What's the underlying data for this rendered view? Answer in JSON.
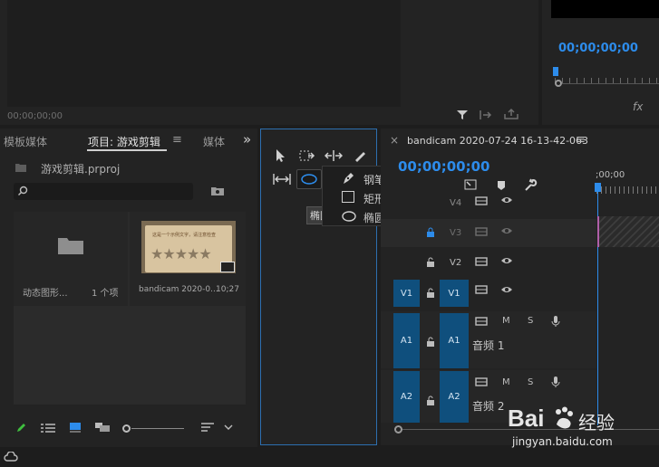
{
  "source_monitor": {
    "timecode": "00;00;00;00"
  },
  "program_monitor": {
    "timecode": "00;00;00;00",
    "fx_label": "fx"
  },
  "project_panel": {
    "tabs": [
      {
        "label": "模板媒体",
        "active": false
      },
      {
        "label": "项目: 游戏剪辑",
        "active": true
      },
      {
        "label": "媒体",
        "active": false
      }
    ],
    "menu_glyph": "≡",
    "overflow_glyph": "»",
    "project_file": "游戏剪辑.prproj",
    "search_placeholder": "",
    "items": [
      {
        "name": "动态图形...",
        "meta": "1 个项",
        "kind": "bin"
      },
      {
        "name": "bandicam 2020-0...",
        "meta": "10;27",
        "kind": "clip"
      }
    ],
    "thumb_text": "这是一个示例文字，请注意检查"
  },
  "tools_panel": {
    "tooltip": "椭圆工具",
    "flyout": [
      {
        "label": "钢笔工具 (P)",
        "icon": "pen-icon"
      },
      {
        "label": "矩形工具",
        "icon": "rectangle-icon"
      },
      {
        "label": "椭圆工具",
        "icon": "ellipse-icon"
      }
    ]
  },
  "timeline": {
    "close_glyph": "×",
    "sequence_name": "bandicam 2020-07-24 16-13-42-063",
    "menu_glyph": "≡",
    "timecode": "00;00;00;00",
    "ruler_label": ";00;00",
    "video_tracks": [
      {
        "src": "",
        "name": "V4"
      },
      {
        "src": "",
        "name": "V3"
      },
      {
        "src": "",
        "name": "V2"
      },
      {
        "src": "V1",
        "name": "V1"
      }
    ],
    "audio_tracks": [
      {
        "src": "A1",
        "name": "A1",
        "label": "音频 1",
        "m": "M",
        "s": "S"
      },
      {
        "src": "A2",
        "name": "A2",
        "label": "音频 2",
        "m": "M",
        "s": "S"
      }
    ]
  },
  "watermark": {
    "brand": "Bai",
    "suffix": "经验",
    "url": "jingyan.baidu.com"
  },
  "colors": {
    "accent_blue": "#2d8ceb",
    "track_blue": "#0f4f7d",
    "panel_bg": "#232323"
  }
}
